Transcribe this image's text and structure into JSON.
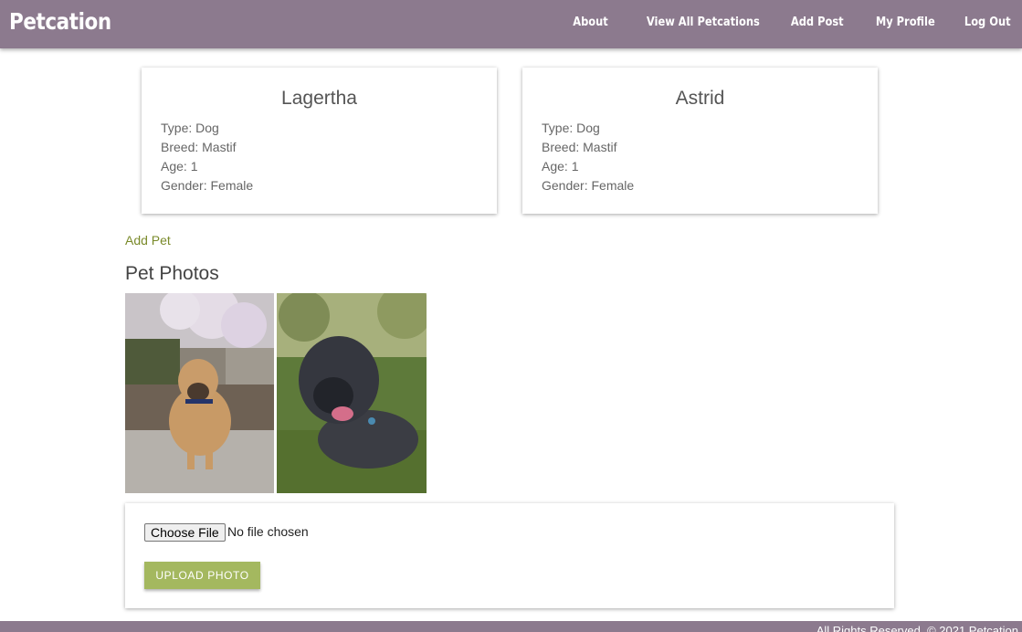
{
  "navbar": {
    "brand": "Petcation",
    "links": [
      "About",
      "View All Petcations",
      "Add Post",
      "My Profile",
      "Log Out"
    ],
    "bg_color": "#8c7a8e"
  },
  "pets": [
    {
      "name": "Lagertha",
      "type": "Type: Dog",
      "breed": "Breed: Mastif",
      "age": "Age: 1",
      "gender": "Gender: Female"
    },
    {
      "name": "Astrid",
      "type": "Type: Dog",
      "breed": "Breed: Mastif",
      "age": "Age: 1",
      "gender": "Gender: Female"
    }
  ],
  "add_pet_link": "Add Pet",
  "photos_section": {
    "title": "Pet Photos",
    "photos": [
      "fawn-mastiff-sitting-photo",
      "brindle-mastiff-lying-photo"
    ]
  },
  "upload": {
    "choose_file_label": "Choose File",
    "no_file_text": "No file chosen",
    "upload_button": "UPLOAD PHOTO",
    "accent_color": "#a4b85f"
  },
  "footer": {
    "text": "All Rights Reserved. © 2021 Petcation"
  }
}
